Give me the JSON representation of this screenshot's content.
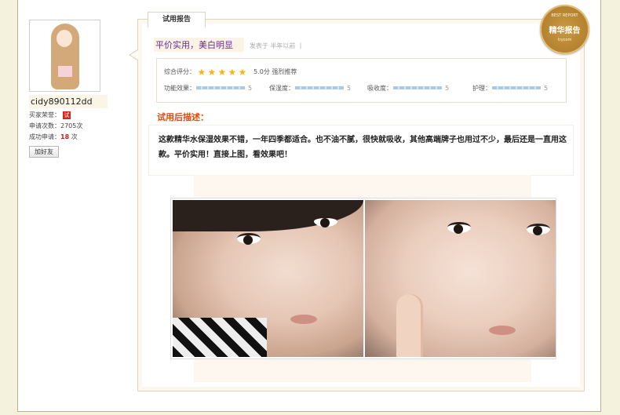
{
  "user": {
    "username": "cidy890112dd",
    "honor_label": "买家荣誉：",
    "honor_badge": "试",
    "apply_count_label": "申请次数：",
    "apply_count_value": "2705次",
    "success_label": "成功申请：",
    "success_value": "18",
    "success_unit": "次",
    "add_friend_label": "加好友"
  },
  "report": {
    "tab_label": "试用报告",
    "title": "平价实用，美白明显",
    "meta": "发表于 半年以前 丨",
    "overall_label": "综合评分：",
    "overall_stars": 5,
    "overall_score": "5.0分 强烈推荐",
    "metrics": [
      {
        "label": "功能效果：",
        "value": "5"
      },
      {
        "label": "保湿度：",
        "value": "5"
      },
      {
        "label": "吸收度：",
        "value": "5"
      },
      {
        "label": "护理：",
        "value": "5"
      }
    ],
    "desc_title": "试用后描述：",
    "desc_text": "这款精华水保湿效果不错，一年四季都适合。也不油不腻，很快就吸收，其他高端牌子也用过不少，最后还是一直用这款。平价实用！直接上图，看效果吧！"
  },
  "seal": {
    "top": "BEST REPORT",
    "main": "精华报告",
    "bottom": "trycom"
  },
  "colors": {
    "accent_orange": "#e4480f",
    "title_purple": "#6a2a91",
    "star_gold": "#f2b51d"
  }
}
